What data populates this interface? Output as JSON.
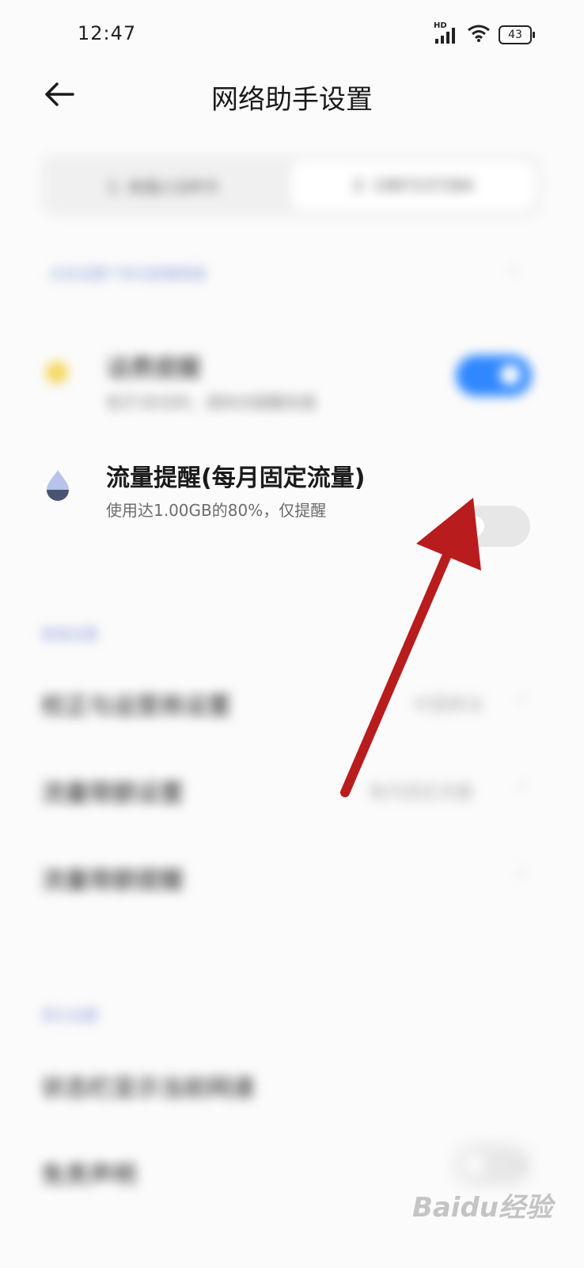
{
  "status_bar": {
    "time": "12:47",
    "network_label": "HD",
    "battery": "43",
    "icons": [
      "signal-icon",
      "wifi-icon",
      "battery-icon"
    ]
  },
  "header": {
    "title": "网络助手设置",
    "back_icon": "arrow-left-icon"
  },
  "sim_tabs": [
    {
      "label": "1: 未插入SIM卡",
      "selected": false
    },
    {
      "label": "2: 1987237284",
      "selected": true
    }
  ],
  "settings_link": {
    "label": "点击设置个性化套餐数据"
  },
  "alerts": [
    {
      "icon": "coin-icon",
      "title": "话费提醒",
      "subtitle": "低于30元时，请你对提醒充值",
      "enabled": true
    },
    {
      "icon": "water-drop-icon",
      "title": "流量提醒(每月固定流量)",
      "subtitle": "使用达1.00GB的80%，仅提醒",
      "enabled": false
    }
  ],
  "data_settings": {
    "section_label": "套餐设置",
    "rows": [
      {
        "title": "校正与运营商设置",
        "value": "中国移动"
      },
      {
        "title": "流量限额设置",
        "value": "每月固定流量"
      },
      {
        "title": "流量限额提醒",
        "value": ""
      }
    ]
  },
  "other_settings": {
    "section_label": "其它设置",
    "rows": [
      {
        "title": "状态栏显示当前网速",
        "type": "toggle",
        "enabled": false
      },
      {
        "title": "免责声明",
        "type": "link"
      }
    ]
  },
  "watermark": "Baidu经验",
  "annotation": {
    "color": "#b81c1c"
  },
  "colors": {
    "toggle_on": "#2f88ff",
    "toggle_off": "#e7e7e7",
    "section_label": "#8c9ad8"
  }
}
